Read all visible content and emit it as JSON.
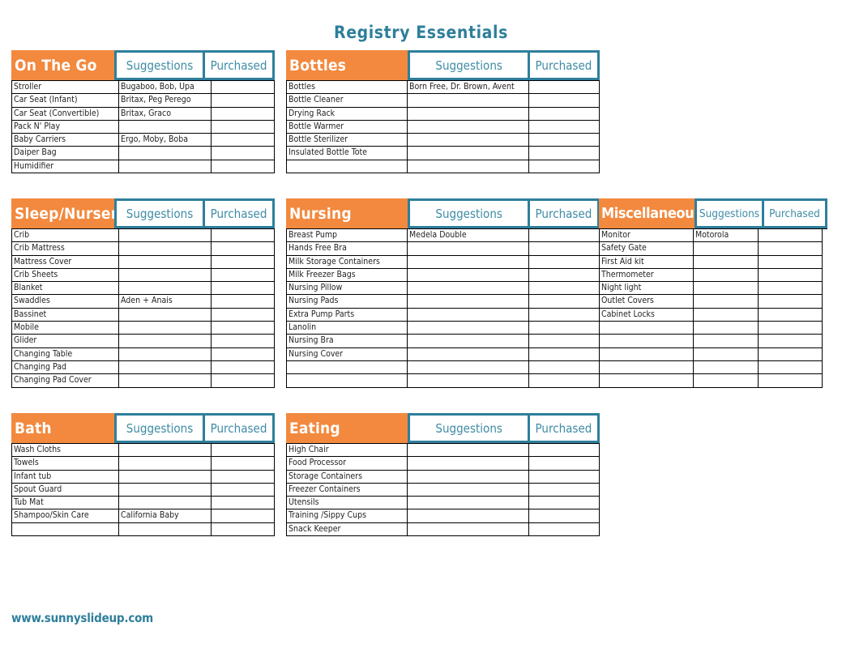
{
  "page": {
    "title": "Registry Essentials",
    "footer_url": "www.sunnyslideup.com"
  },
  "colors": {
    "orange": "#F2893E",
    "teal": "#2E7F9B",
    "teal_text": "#3E8CA5",
    "grid": "#000000"
  },
  "column_headers": {
    "suggestions": "Suggestions",
    "purchased": "Purchased"
  },
  "blocks": [
    {
      "id": "block-a",
      "tables": [
        {
          "id": "on-the-go",
          "title": "On The Go",
          "col_suggestions": "Suggestions",
          "col_purchased": "Purchased",
          "rows": [
            {
              "item": "Stroller",
              "suggestions": "Bugaboo, Bob, Upa",
              "purchased": ""
            },
            {
              "item": "Car Seat (Infant)",
              "suggestions": "Britax, Peg Perego",
              "purchased": ""
            },
            {
              "item": "Car Seat (Convertible)",
              "suggestions": "Britax, Graco",
              "purchased": ""
            },
            {
              "item": "Pack N' Play",
              "suggestions": "",
              "purchased": ""
            },
            {
              "item": "Baby Carriers",
              "suggestions": "Ergo, Moby, Boba",
              "purchased": ""
            },
            {
              "item": "Daiper Bag",
              "suggestions": "",
              "purchased": ""
            },
            {
              "item": "Humidifier",
              "suggestions": "",
              "purchased": ""
            }
          ]
        },
        {
          "id": "bottles",
          "title": "Bottles",
          "col_suggestions": "Suggestions",
          "col_purchased": "Purchased",
          "rows": [
            {
              "item": "Bottles",
              "suggestions": "Born Free, Dr. Brown, Avent",
              "purchased": ""
            },
            {
              "item": "Bottle Cleaner",
              "suggestions": "",
              "purchased": ""
            },
            {
              "item": "Drying Rack",
              "suggestions": "",
              "purchased": ""
            },
            {
              "item": "Bottle Warmer",
              "suggestions": "",
              "purchased": ""
            },
            {
              "item": "Bottle Sterilizer",
              "suggestions": "",
              "purchased": ""
            },
            {
              "item": "Insulated Bottle Tote",
              "suggestions": "",
              "purchased": ""
            },
            {
              "item": "",
              "suggestions": "",
              "purchased": ""
            }
          ]
        }
      ]
    },
    {
      "id": "block-b",
      "tables": [
        {
          "id": "sleep-nursery",
          "title": "Sleep/Nursery",
          "col_suggestions": "Suggestions",
          "col_purchased": "Purchased",
          "rows": [
            {
              "item": "Crib",
              "suggestions": "",
              "purchased": ""
            },
            {
              "item": "Crib Mattress",
              "suggestions": "",
              "purchased": ""
            },
            {
              "item": "Mattress Cover",
              "suggestions": "",
              "purchased": ""
            },
            {
              "item": "Crib Sheets",
              "suggestions": "",
              "purchased": ""
            },
            {
              "item": "Blanket",
              "suggestions": "",
              "purchased": ""
            },
            {
              "item": "Swaddles",
              "suggestions": "Aden + Anais",
              "purchased": ""
            },
            {
              "item": "Bassinet",
              "suggestions": "",
              "purchased": ""
            },
            {
              "item": "Mobile",
              "suggestions": "",
              "purchased": ""
            },
            {
              "item": "Glider",
              "suggestions": "",
              "purchased": ""
            },
            {
              "item": "Changing Table",
              "suggestions": "",
              "purchased": ""
            },
            {
              "item": "Changing Pad",
              "suggestions": "",
              "purchased": ""
            },
            {
              "item": "Changing Pad Cover",
              "suggestions": "",
              "purchased": ""
            }
          ]
        },
        {
          "id": "nursing",
          "title": "Nursing",
          "col_suggestions": "Suggestions",
          "col_purchased": "Purchased",
          "rows": [
            {
              "item": "Breast Pump",
              "suggestions": "Medela Double",
              "purchased": ""
            },
            {
              "item": "Hands Free Bra",
              "suggestions": "",
              "purchased": ""
            },
            {
              "item": "Milk Storage Containers",
              "suggestions": "",
              "purchased": ""
            },
            {
              "item": "Milk Freezer Bags",
              "suggestions": "",
              "purchased": ""
            },
            {
              "item": "Nursing Pillow",
              "suggestions": "",
              "purchased": ""
            },
            {
              "item": "Nursing Pads",
              "suggestions": "",
              "purchased": ""
            },
            {
              "item": "Extra Pump Parts",
              "suggestions": "",
              "purchased": ""
            },
            {
              "item": "Lanolin",
              "suggestions": "",
              "purchased": ""
            },
            {
              "item": "Nursing Bra",
              "suggestions": "",
              "purchased": ""
            },
            {
              "item": "Nursing Cover",
              "suggestions": "",
              "purchased": ""
            },
            {
              "item": "",
              "suggestions": "",
              "purchased": ""
            },
            {
              "item": "",
              "suggestions": "",
              "purchased": ""
            }
          ]
        },
        {
          "id": "miscellaneous",
          "title": "Miscellaneous",
          "col_suggestions": "Suggestions",
          "col_purchased": "Purchased",
          "rows": [
            {
              "item": "Monitor",
              "suggestions": "Motorola",
              "purchased": ""
            },
            {
              "item": "Safety Gate",
              "suggestions": "",
              "purchased": ""
            },
            {
              "item": "First Aid kit",
              "suggestions": "",
              "purchased": ""
            },
            {
              "item": "Thermometer",
              "suggestions": "",
              "purchased": ""
            },
            {
              "item": "Night light",
              "suggestions": "",
              "purchased": ""
            },
            {
              "item": "Outlet Covers",
              "suggestions": "",
              "purchased": ""
            },
            {
              "item": "Cabinet Locks",
              "suggestions": "",
              "purchased": ""
            },
            {
              "item": "",
              "suggestions": "",
              "purchased": ""
            },
            {
              "item": "",
              "suggestions": "",
              "purchased": ""
            },
            {
              "item": "",
              "suggestions": "",
              "purchased": ""
            },
            {
              "item": "",
              "suggestions": "",
              "purchased": ""
            },
            {
              "item": "",
              "suggestions": "",
              "purchased": ""
            }
          ]
        }
      ]
    },
    {
      "id": "block-c",
      "tables": [
        {
          "id": "bath",
          "title": "Bath",
          "col_suggestions": "Suggestions",
          "col_purchased": "Purchased",
          "rows": [
            {
              "item": "Wash Cloths",
              "suggestions": "",
              "purchased": ""
            },
            {
              "item": "Towels",
              "suggestions": "",
              "purchased": ""
            },
            {
              "item": "Infant tub",
              "suggestions": "",
              "purchased": ""
            },
            {
              "item": "Spout Guard",
              "suggestions": "",
              "purchased": ""
            },
            {
              "item": "Tub Mat",
              "suggestions": "",
              "purchased": ""
            },
            {
              "item": "Shampoo/Skin Care",
              "suggestions": "California Baby",
              "purchased": ""
            },
            {
              "item": "",
              "suggestions": "",
              "purchased": ""
            }
          ]
        },
        {
          "id": "eating",
          "title": "Eating",
          "col_suggestions": "Suggestions",
          "col_purchased": "Purchased",
          "rows": [
            {
              "item": "High Chair",
              "suggestions": "",
              "purchased": ""
            },
            {
              "item": "Food Processor",
              "suggestions": "",
              "purchased": ""
            },
            {
              "item": "Storage Containers",
              "suggestions": "",
              "purchased": ""
            },
            {
              "item": "Freezer Containers",
              "suggestions": "",
              "purchased": ""
            },
            {
              "item": "Utensils",
              "suggestions": "",
              "purchased": ""
            },
            {
              "item": "Training /Sippy Cups",
              "suggestions": "",
              "purchased": ""
            },
            {
              "item": "Snack Keeper",
              "suggestions": "",
              "purchased": ""
            }
          ]
        }
      ]
    }
  ]
}
